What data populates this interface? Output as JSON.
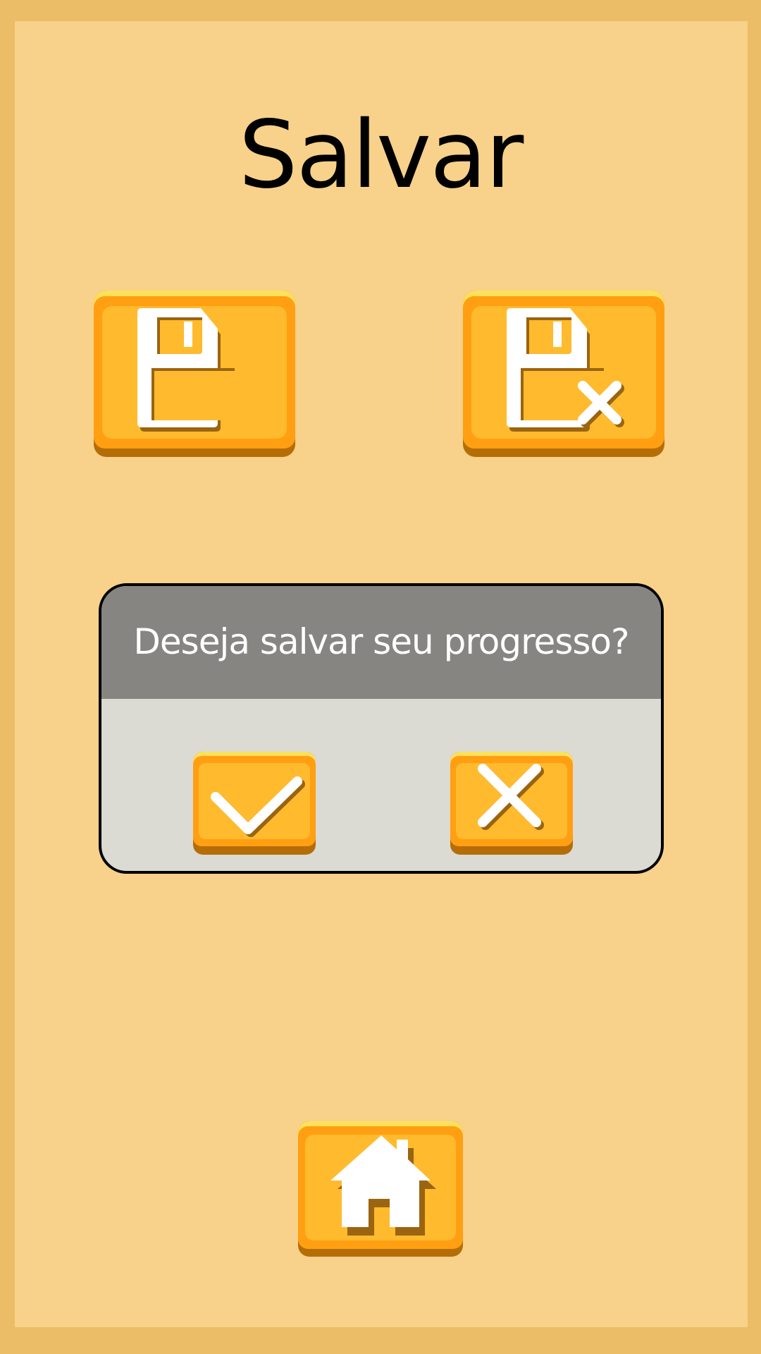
{
  "screen": {
    "title": "Salvar"
  },
  "dialog": {
    "question": "Deseja salvar seu progresso?"
  },
  "buttons": {
    "save": {
      "icon": "floppy-disk-icon"
    },
    "delete_save": {
      "icon": "floppy-disk-delete-icon"
    },
    "confirm": {
      "icon": "checkmark-icon"
    },
    "cancel": {
      "icon": "close-icon"
    },
    "home": {
      "icon": "home-icon"
    }
  },
  "colors": {
    "outer_frame": "#ebbd66",
    "background": "#f8d18a",
    "button_face": "#ff9f11",
    "button_inner": "#ffba2e",
    "button_rim": "#fee15b",
    "button_shadow": "#b56e07",
    "dialog_header": "#868581",
    "dialog_body": "#dbdad3"
  }
}
